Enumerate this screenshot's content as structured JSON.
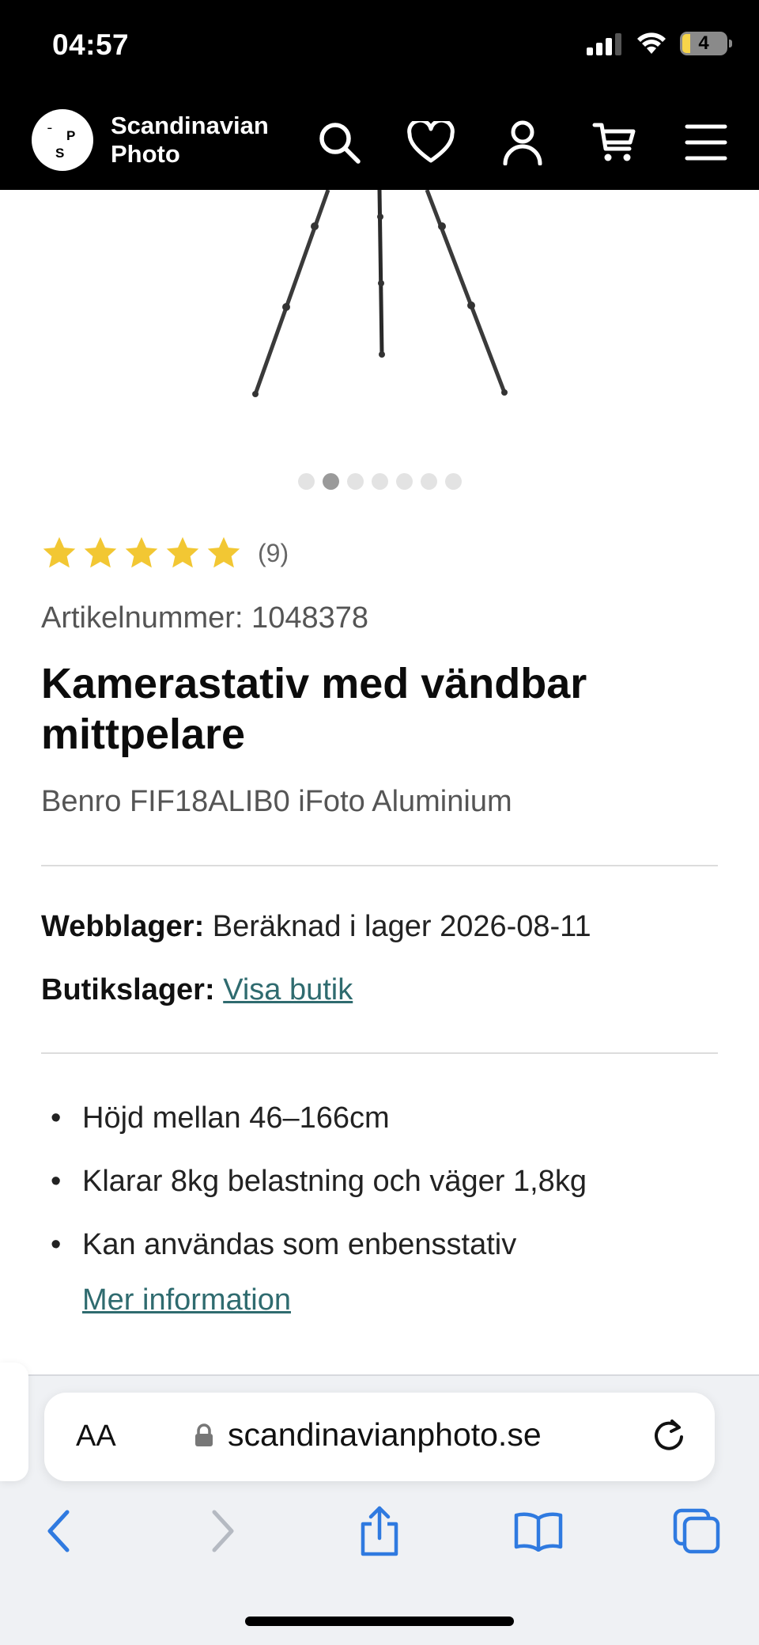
{
  "status_bar": {
    "time": "04:57",
    "battery": "4"
  },
  "header": {
    "logo_line1": "Scandinavian",
    "logo_line2": "Photo",
    "logo_glyph_1": "S",
    "logo_glyph_2": "P",
    "icons": [
      "search-icon",
      "heart-icon",
      "user-icon",
      "cart-icon",
      "menu-icon"
    ]
  },
  "gallery": {
    "dot_count": 7,
    "active_index": 1
  },
  "product": {
    "rating_stars": 5,
    "rating_count": "(9)",
    "article_number": "Artikelnummer: 1048378",
    "title": "Kamerastativ med vändbar mittpelare",
    "subtitle": "Benro FIF18ALIB0 iFoto Aluminium",
    "web_stock_label": "Webblager:",
    "web_stock_value": "Beräknad i lager 2026-08-11",
    "store_stock_label": "Butikslager:",
    "store_stock_link": "Visa butik",
    "features": [
      "Höjd mellan 46–166cm",
      "Klarar 8kg belastning och väger 1,8kg",
      "Kan användas som enbensstativ"
    ],
    "more_info": "Mer information"
  },
  "browser": {
    "text_size_label": "AA",
    "url": "scandinavianphoto.se",
    "nav_icons": [
      "back-icon",
      "forward-icon",
      "share-icon",
      "bookmarks-icon",
      "tabs-icon"
    ]
  },
  "colors": {
    "link": "#2f6b6f",
    "star": "#f2c733",
    "header_bg": "#000000"
  }
}
